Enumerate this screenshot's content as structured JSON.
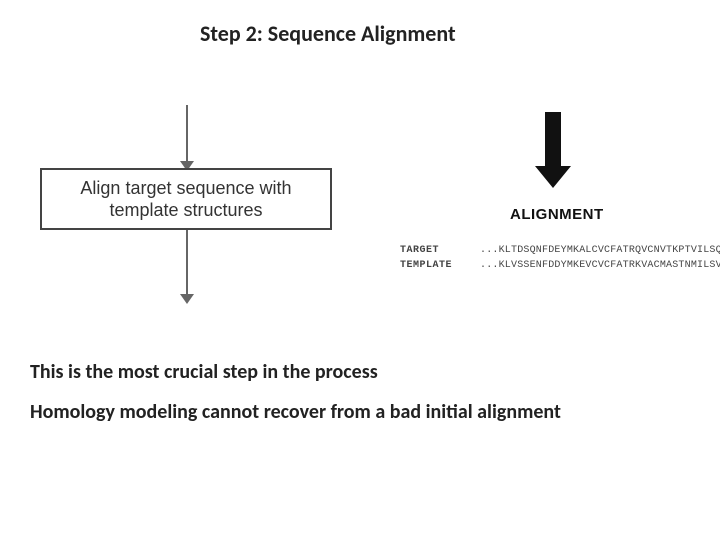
{
  "title": "Step 2: Sequence Alignment",
  "step_box_text": "Align target sequence with template structures",
  "alignment_label": "ALIGNMENT",
  "sequences": {
    "target": {
      "name": "TARGET",
      "value": "...KLTDSQNFDEYMKALCVCFATRQVCNVTKPTVILSQEGCKVV..."
    },
    "template": {
      "name": "TEMPLATE",
      "value": "...KLVSSENFDDYMKEVCVCFATRKVACMASTNMILSVNSDCVT..."
    }
  },
  "body_line_1": "This is the most crucial step in the process",
  "body_line_2": "Homology modeling cannot recover from a bad initial alignment"
}
